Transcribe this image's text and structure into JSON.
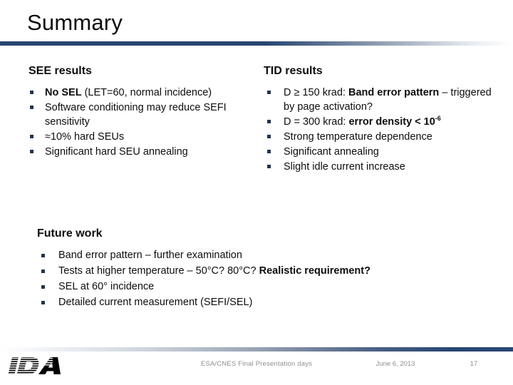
{
  "slide": {
    "title": "Summary",
    "accent_color": "#274672",
    "bullet_color": "#21354f",
    "text_color": "#0d0d0d"
  },
  "see": {
    "heading": "SEE results",
    "bullets": [
      {
        "bold_prefix": "No SEL",
        "rest": " (LET=60, normal incidence)"
      },
      {
        "bold_prefix": "",
        "rest": "Software conditioning may reduce SEFI sensitivity"
      },
      {
        "bold_prefix": "",
        "rest": "≈10% hard SEUs"
      },
      {
        "bold_prefix": "",
        "rest": "Significant hard SEU annealing"
      }
    ]
  },
  "tid": {
    "heading": "TID results",
    "bullets": [
      {
        "lead": "D ≥ 150 krad: ",
        "bold": "Band error pattern",
        "tail": " – triggered by page activation?"
      },
      {
        "lead": "D = 300 krad: ",
        "bold": "error density < 10",
        "sup": "-6",
        "tail": ""
      },
      {
        "lead": "Strong temperature dependence",
        "bold": "",
        "tail": ""
      },
      {
        "lead": "Significant annealing",
        "bold": "",
        "tail": ""
      },
      {
        "lead": "Slight idle current increase",
        "bold": "",
        "tail": ""
      }
    ]
  },
  "future": {
    "heading": "Future work",
    "bullets": [
      {
        "lead": "Band error pattern – further examination",
        "bold": ""
      },
      {
        "lead": "Tests at higher temperature – 50°C? 80°C? ",
        "bold": "Realistic requirement?"
      },
      {
        "lead": "SEL at 60° incidence",
        "bold": ""
      },
      {
        "lead": "Detailed current measurement (SEFI/SEL)",
        "bold": ""
      }
    ]
  },
  "footer": {
    "logo_text": "IDA",
    "center_text": "ESA/CNES Final Presentation days",
    "date": "June 6, 2013",
    "page_number": "17"
  }
}
